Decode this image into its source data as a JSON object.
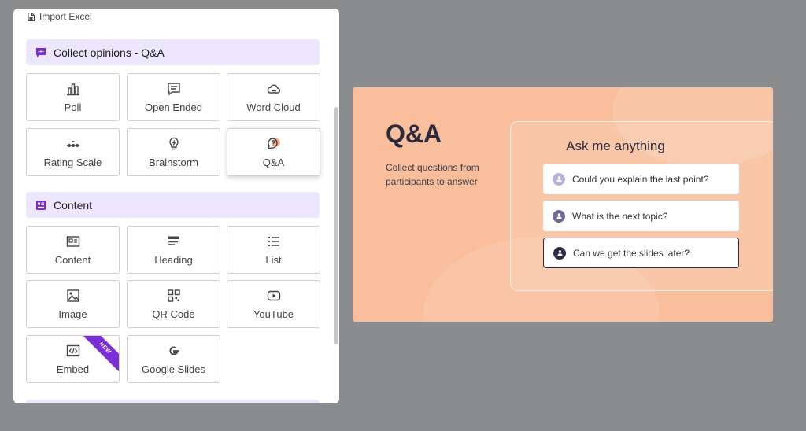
{
  "panel": {
    "import_label": "Import Excel",
    "sections": [
      {
        "title": "Collect opinions - Q&A",
        "icon": "comment-dots-icon"
      },
      {
        "title": "Content",
        "icon": "content-block-icon"
      }
    ],
    "collect_tiles": [
      {
        "label": "Poll",
        "icon": "bar-chart-icon"
      },
      {
        "label": "Open Ended",
        "icon": "message-lines-icon"
      },
      {
        "label": "Word Cloud",
        "icon": "cloud-icon"
      },
      {
        "label": "Rating Scale",
        "icon": "slider-scale-icon"
      },
      {
        "label": "Brainstorm",
        "icon": "lightbulb-icon"
      },
      {
        "label": "Q&A",
        "icon": "question-bubble-icon"
      }
    ],
    "content_tiles": [
      {
        "label": "Content",
        "icon": "id-card-icon"
      },
      {
        "label": "Heading",
        "icon": "heading-lines-icon"
      },
      {
        "label": "List",
        "icon": "list-icon"
      },
      {
        "label": "Image",
        "icon": "image-icon"
      },
      {
        "label": "QR Code",
        "icon": "qr-code-icon"
      },
      {
        "label": "YouTube",
        "icon": "youtube-icon"
      },
      {
        "label": "Embed",
        "icon": "code-icon",
        "badge": "NEW"
      },
      {
        "label": "Google Slides",
        "icon": "google-icon"
      }
    ]
  },
  "slide": {
    "title": "Q&A",
    "subtitle": "Collect questions from participants to answer",
    "card_heading": "Ask me anything",
    "questions": [
      {
        "text": "Could you explain the last point?",
        "avatar_color": "#b7b3d8"
      },
      {
        "text": "What is the next topic?",
        "avatar_color": "#6e6a93"
      },
      {
        "text": "Can we get the slides later?",
        "avatar_color": "#2f2b4a"
      }
    ]
  },
  "colors": {
    "background": "#8a8c8d",
    "section_bg": "#ece6ff",
    "accent_purple": "#7a2fd6",
    "slide_bg": "#f9bf9c",
    "slide_text": "#2b2a3d"
  }
}
